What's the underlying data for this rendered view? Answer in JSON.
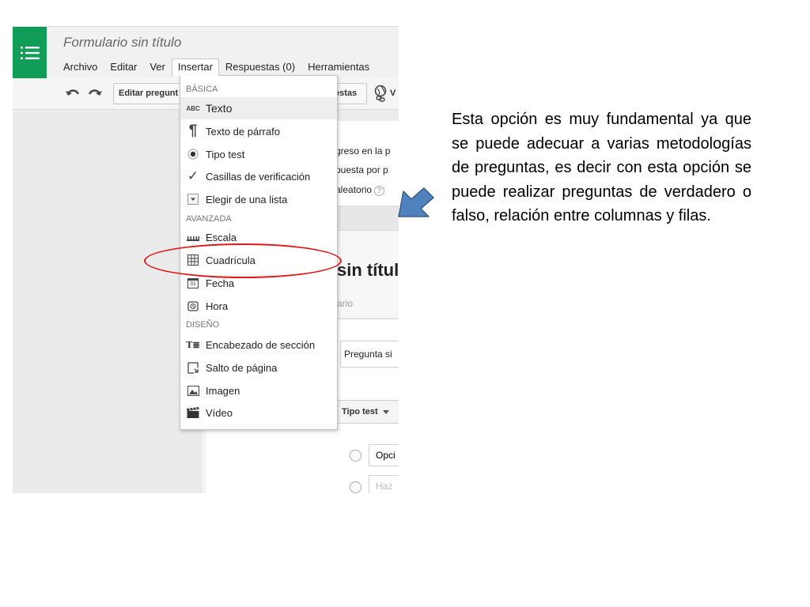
{
  "window": {
    "title": "Formulario sin título"
  },
  "menubar": {
    "items": [
      {
        "label": "Archivo"
      },
      {
        "label": "Editar"
      },
      {
        "label": "Ver"
      },
      {
        "label": "Insertar",
        "active": true
      },
      {
        "label": "Respuestas (0)"
      },
      {
        "label": "Herramientas"
      }
    ]
  },
  "toolbar": {
    "edit_questions_label": "Editar pregunt",
    "responses_label": "estas",
    "view_label": "V"
  },
  "form": {
    "settings_lines": [
      "greso en la p",
      "puesta por p",
      "aleatorio"
    ],
    "help_badge": "?",
    "heading": "sin títul",
    "description": "ario",
    "question_title": "Pregunta si",
    "question_type": "Tipo test",
    "option_1": "Opci",
    "option_2": "Haz"
  },
  "insert_menu": {
    "sections": [
      {
        "label": "BÁSICA",
        "items": [
          {
            "label": "Texto",
            "icon": "abc-text-icon",
            "glyph": "ABC",
            "highlighted": true
          },
          {
            "label": "Texto de párrafo",
            "icon": "paragraph-icon",
            "glyph": "¶"
          },
          {
            "label": "Tipo test",
            "icon": "radio-button-icon"
          },
          {
            "label": "Casillas de verificación",
            "icon": "checkmark-icon",
            "glyph": "✓"
          },
          {
            "label": "Elegir de una lista",
            "icon": "dropdown-list-icon"
          }
        ]
      },
      {
        "label": "AVANZADA",
        "items": [
          {
            "label": "Escala",
            "icon": "scale-icon"
          },
          {
            "label": "Cuadrícula",
            "icon": "grid-icon"
          },
          {
            "label": "Fecha",
            "icon": "calendar-icon",
            "glyph": "31"
          },
          {
            "label": "Hora",
            "icon": "clock-icon"
          }
        ]
      },
      {
        "label": "DISEÑO",
        "items": [
          {
            "label": "Encabezado de sección",
            "icon": "section-header-icon",
            "glyph": "T≣"
          },
          {
            "label": "Salto de página",
            "icon": "page-break-icon"
          },
          {
            "label": "Imagen",
            "icon": "image-icon"
          },
          {
            "label": "Vídeo",
            "icon": "video-icon"
          }
        ]
      }
    ]
  },
  "annotation": {
    "text": "Esta opción es muy fundamental ya que se puede adecuar a varias metodologías de preguntas, es decir con esta opción se puede realizar preguntas de verdadero o falso, relación entre columnas y filas.",
    "ellipse_color": "#e0191a",
    "arrow_color": "#4f81bd"
  },
  "colors": {
    "forms_green": "#0f9d58"
  }
}
